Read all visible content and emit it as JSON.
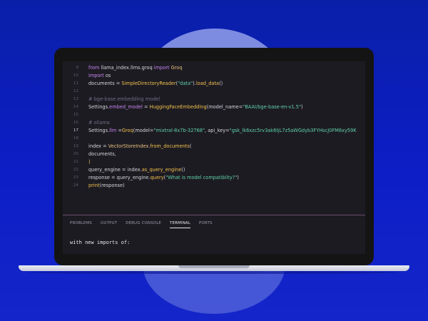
{
  "editor": {
    "lines": [
      {
        "num": "9",
        "active": false,
        "tokens": [
          {
            "t": "from ",
            "c": "kw"
          },
          {
            "t": "llama_index.llms.groq ",
            "c": "op"
          },
          {
            "t": "import ",
            "c": "kw"
          },
          {
            "t": "Groq",
            "c": "cls"
          }
        ]
      },
      {
        "num": "10",
        "active": false,
        "tokens": [
          {
            "t": "import ",
            "c": "kw"
          },
          {
            "t": "os",
            "c": "op"
          }
        ]
      },
      {
        "num": "11",
        "active": false,
        "tokens": [
          {
            "t": "documents = ",
            "c": "op"
          },
          {
            "t": "SimpleDirectoryReader",
            "c": "fn"
          },
          {
            "t": "(",
            "c": "op"
          },
          {
            "t": "\"data\"",
            "c": "str"
          },
          {
            "t": ").",
            "c": "op"
          },
          {
            "t": "load_data",
            "c": "fn"
          },
          {
            "t": "()",
            "c": "op"
          }
        ]
      },
      {
        "num": "12",
        "active": false,
        "tokens": []
      },
      {
        "num": "13",
        "active": false,
        "tokens": [
          {
            "t": "# bge-base embedding model",
            "c": "cmt"
          }
        ]
      },
      {
        "num": "14",
        "active": false,
        "tokens": [
          {
            "t": "Settings.",
            "c": "op"
          },
          {
            "t": "embed_model",
            "c": "kw"
          },
          {
            "t": " = ",
            "c": "op"
          },
          {
            "t": "HuggingFaceEmbedding",
            "c": "fn"
          },
          {
            "t": "(model_name=",
            "c": "op"
          },
          {
            "t": "\"BAAI/bge-base-en-v1.5\"",
            "c": "str"
          },
          {
            "t": ")",
            "c": "op"
          }
        ]
      },
      {
        "num": "15",
        "active": false,
        "tokens": []
      },
      {
        "num": "16",
        "active": false,
        "tokens": [
          {
            "t": "# ollama",
            "c": "cmt"
          }
        ]
      },
      {
        "num": "17",
        "active": true,
        "tokens": [
          {
            "t": "Settings.",
            "c": "op"
          },
          {
            "t": "llm",
            "c": "kw"
          },
          {
            "t": " =",
            "c": "op"
          },
          {
            "t": "Groq",
            "c": "fn"
          },
          {
            "t": "(model=",
            "c": "op"
          },
          {
            "t": "\"mixtral-8x7b-32768\"",
            "c": "str"
          },
          {
            "t": ", api_key=",
            "c": "op"
          },
          {
            "t": "\"gsk_lk6xzc5rv3ak6tjL7z5aWGdyb3FYHscJ0FM6xy59K",
            "c": "str"
          }
        ]
      },
      {
        "num": "18",
        "active": false,
        "tokens": []
      },
      {
        "num": "19",
        "active": false,
        "tokens": [
          {
            "t": "index = ",
            "c": "op"
          },
          {
            "t": "VectorStoreIndex",
            "c": "cls"
          },
          {
            "t": ".",
            "c": "op"
          },
          {
            "t": "from_documents",
            "c": "fn"
          },
          {
            "t": "(",
            "c": "op"
          }
        ]
      },
      {
        "num": "20",
        "active": false,
        "tokens": [
          {
            "t": "    documents,",
            "c": "op"
          }
        ]
      },
      {
        "num": "21",
        "active": false,
        "tokens": [
          {
            "t": ")",
            "c": "fn"
          }
        ]
      },
      {
        "num": "22",
        "active": false,
        "tokens": [
          {
            "t": "query_engine = index.",
            "c": "op"
          },
          {
            "t": "as_query_engine",
            "c": "fn"
          },
          {
            "t": "()",
            "c": "op"
          }
        ]
      },
      {
        "num": "23",
        "active": false,
        "tokens": [
          {
            "t": "response = query_engine.",
            "c": "op"
          },
          {
            "t": "query",
            "c": "fn"
          },
          {
            "t": "(",
            "c": "op"
          },
          {
            "t": "\"What is model compatiblity?\"",
            "c": "str"
          },
          {
            "t": ")",
            "c": "op"
          }
        ]
      },
      {
        "num": "24",
        "active": false,
        "tokens": [
          {
            "t": "print",
            "c": "fn"
          },
          {
            "t": "(response)",
            "c": "op"
          }
        ]
      }
    ]
  },
  "panel": {
    "tabs": [
      {
        "label": "PROBLEMS",
        "active": false
      },
      {
        "label": "OUTPUT",
        "active": false
      },
      {
        "label": "DEBUG CONSOLE",
        "active": false
      },
      {
        "label": "TERMINAL",
        "active": true
      },
      {
        "label": "PORTS",
        "active": false
      }
    ],
    "terminal_text": "with new imports of:"
  }
}
